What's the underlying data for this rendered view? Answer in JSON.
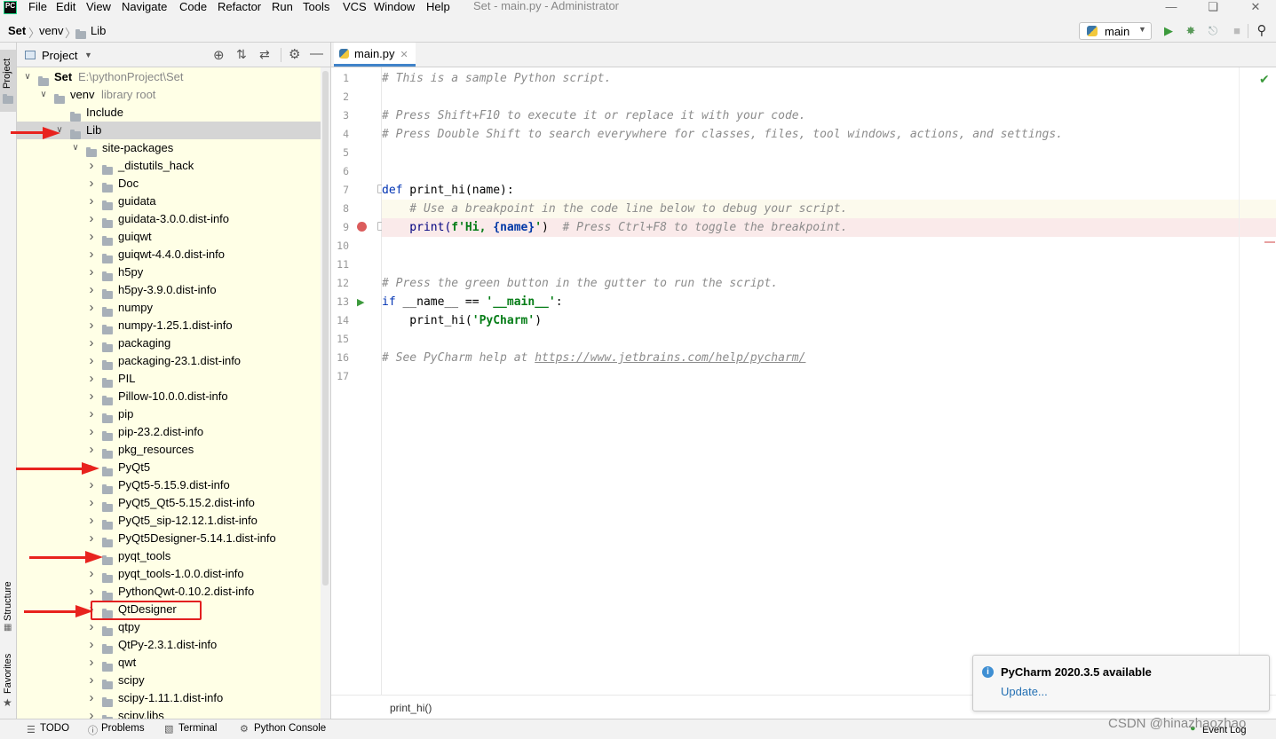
{
  "menubar": {
    "logo_text": "PC",
    "items": [
      "File",
      "Edit",
      "View",
      "Navigate",
      "Code",
      "Refactor",
      "Run",
      "Tools",
      "VCS",
      "Window",
      "Help"
    ],
    "window_title": "Set - main.py - Administrator"
  },
  "navbar": {
    "crumbs": [
      "Set",
      "venv",
      "Lib"
    ],
    "run_config": "main"
  },
  "left_stripe": {
    "top_tab": "Project",
    "structure_tab": "Structure",
    "favorites_tab": "Favorites"
  },
  "project_panel": {
    "title": "Project",
    "tree": [
      {
        "label": "Set",
        "hint": "E:\\pythonProject\\Set"
      },
      {
        "label": "venv",
        "hint": "library root"
      },
      {
        "label": "Include"
      },
      {
        "label": "Lib"
      },
      {
        "label": "site-packages"
      },
      {
        "label": "_distutils_hack"
      },
      {
        "label": "Doc"
      },
      {
        "label": "guidata"
      },
      {
        "label": "guidata-3.0.0.dist-info"
      },
      {
        "label": "guiqwt"
      },
      {
        "label": "guiqwt-4.4.0.dist-info"
      },
      {
        "label": "h5py"
      },
      {
        "label": "h5py-3.9.0.dist-info"
      },
      {
        "label": "numpy"
      },
      {
        "label": "numpy-1.25.1.dist-info"
      },
      {
        "label": "packaging"
      },
      {
        "label": "packaging-23.1.dist-info"
      },
      {
        "label": "PIL"
      },
      {
        "label": "Pillow-10.0.0.dist-info"
      },
      {
        "label": "pip"
      },
      {
        "label": "pip-23.2.dist-info"
      },
      {
        "label": "pkg_resources"
      },
      {
        "label": "PyQt5"
      },
      {
        "label": "PyQt5-5.15.9.dist-info"
      },
      {
        "label": "PyQt5_Qt5-5.15.2.dist-info"
      },
      {
        "label": "PyQt5_sip-12.12.1.dist-info"
      },
      {
        "label": "PyQt5Designer-5.14.1.dist-info"
      },
      {
        "label": "pyqt_tools"
      },
      {
        "label": "pyqt_tools-1.0.0.dist-info"
      },
      {
        "label": "PythonQwt-0.10.2.dist-info"
      },
      {
        "label": "QtDesigner"
      },
      {
        "label": "qtpy"
      },
      {
        "label": "QtPy-2.3.1.dist-info"
      },
      {
        "label": "qwt"
      },
      {
        "label": "scipy"
      },
      {
        "label": "scipy-1.11.1.dist-info"
      },
      {
        "label": "scipy.libs"
      }
    ]
  },
  "editor": {
    "tab_label": "main.py",
    "line_numbers": [
      "1",
      "2",
      "3",
      "4",
      "5",
      "6",
      "7",
      "8",
      "9",
      "10",
      "11",
      "12",
      "13",
      "14",
      "15",
      "16",
      "17"
    ],
    "code": {
      "l1": "# This is a sample Python script.",
      "l3": "# Press Shift+F10 to execute it or replace it with your code.",
      "l4": "# Press Double Shift to search everywhere for classes, files, tool windows, actions, and settings.",
      "l7_kw": "def",
      "l7_rest": " print_hi(name):",
      "l8": "    # Use a breakpoint in the code line below to debug your script.",
      "l9_a": "    print(",
      "l9_str": "f'Hi, ",
      "l9_b": "{name}",
      "l9_str2": "'",
      "l9_c": ")  ",
      "l9_cmt": "# Press Ctrl+F8 to toggle the breakpoint.",
      "l12": "# Press the green button in the gutter to run the script.",
      "l13_kw": "if",
      "l13_a": " __name__ == ",
      "l13_str": "'__main__'",
      "l13_b": ":",
      "l14_a": "    print_hi(",
      "l14_str": "'PyCharm'",
      "l14_b": ")",
      "l16_a": "# See PyCharm help at ",
      "l16_link": "https://www.jetbrains.com/help/pycharm/"
    },
    "breadcrumb": "print_hi()"
  },
  "notification": {
    "title": "PyCharm 2020.3.5 available",
    "action": "Update..."
  },
  "statusbar": {
    "items": [
      "TODO",
      "Problems",
      "Terminal",
      "Python Console"
    ],
    "event_log": "Event Log"
  },
  "watermark": "CSDN @hinazhaozhao",
  "colors": {
    "accent": "#4083c9",
    "annotation": "#e8231e",
    "tree_bg": "#ffffe6",
    "breakpoint": "#db5c5c"
  }
}
